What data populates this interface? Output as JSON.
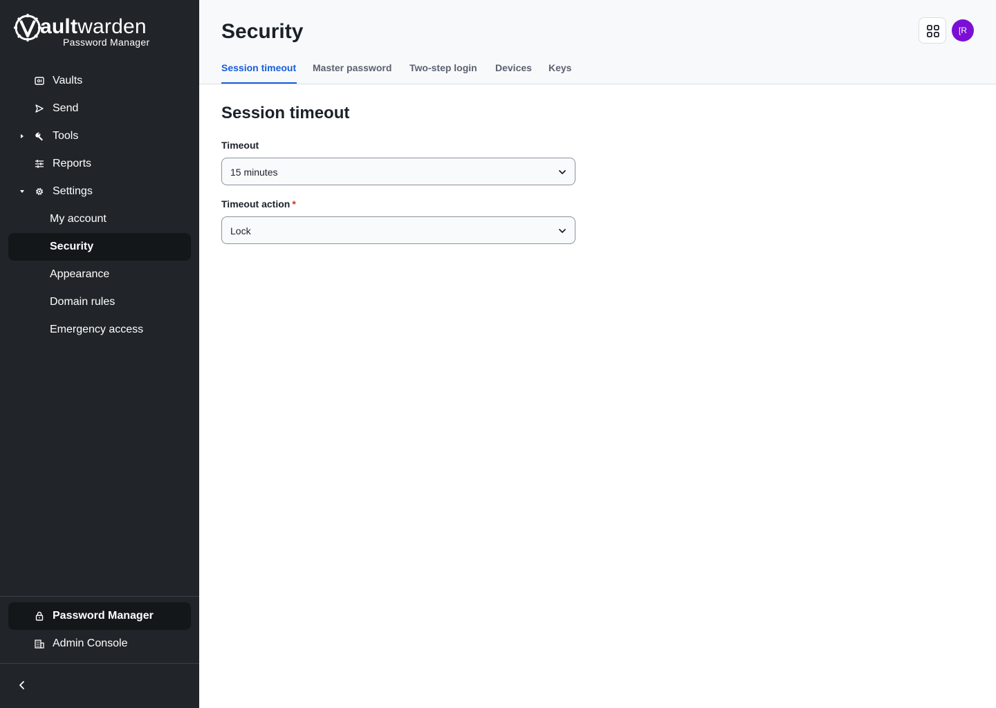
{
  "app": {
    "logo_bold": "ault",
    "logo_rest": "warden",
    "logo_sub": "Password Manager"
  },
  "sidebar": {
    "items": [
      {
        "label": "Vaults",
        "icon": "vault-icon"
      },
      {
        "label": "Send",
        "icon": "send-icon"
      },
      {
        "label": "Tools",
        "icon": "wrench-icon"
      },
      {
        "label": "Reports",
        "icon": "sliders-icon"
      },
      {
        "label": "Settings",
        "icon": "gear-icon"
      },
      {
        "label": "My account"
      },
      {
        "label": "Security"
      },
      {
        "label": "Appearance"
      },
      {
        "label": "Domain rules"
      },
      {
        "label": "Emergency access"
      }
    ],
    "products": [
      {
        "label": "Password Manager",
        "icon": "lock-icon"
      },
      {
        "label": "Admin Console",
        "icon": "building-icon"
      }
    ]
  },
  "header": {
    "title": "Security",
    "avatar_initials": "[R",
    "tabs": [
      {
        "label": "Session timeout"
      },
      {
        "label": "Master password"
      },
      {
        "label": "Two-step login"
      },
      {
        "label": "Devices"
      },
      {
        "label": "Keys"
      }
    ]
  },
  "main": {
    "section_title": "Session timeout",
    "timeout_label": "Timeout",
    "timeout_value": "15 minutes",
    "timeout_action_label": "Timeout action",
    "required_mark": "*",
    "timeout_action_value": "Lock"
  },
  "colors": {
    "sidebar_bg": "#212529",
    "accent": "#175ddc",
    "avatar": "#7b0fd6",
    "required": "#c83522"
  }
}
